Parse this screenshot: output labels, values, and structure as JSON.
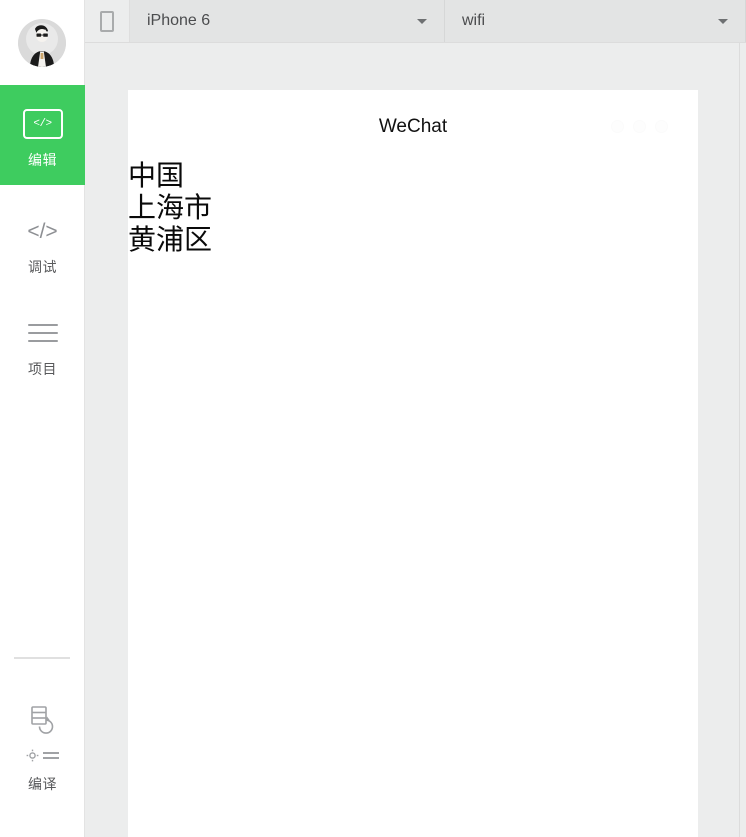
{
  "sidebar": {
    "avatar": {
      "name": "user-avatar",
      "alt": "user profile picture"
    },
    "items": [
      {
        "id": "edit",
        "label": "编辑",
        "icon": "code-box-icon",
        "icon_text": "</>",
        "active": true
      },
      {
        "id": "debug",
        "label": "调试",
        "icon": "code-brackets-icon",
        "icon_text": "</>",
        "active": false
      },
      {
        "id": "project",
        "label": "项目",
        "icon": "hamburger-lines-icon",
        "icon_text": "",
        "active": false
      },
      {
        "id": "compile",
        "label": "编译",
        "icon": "compile-refresh-icon",
        "icon_text": "",
        "active": false
      }
    ],
    "active_color": "#3ecc5f"
  },
  "toolbar": {
    "device_toggle": {
      "label": "",
      "icon": "phone-outline-icon"
    },
    "device_select": {
      "value": "iPhone 6",
      "placeholder": "iPhone 6"
    },
    "network_select": {
      "value": "wifi",
      "placeholder": "wifi"
    },
    "caret_icon": "chevron-down-icon"
  },
  "simulator": {
    "header": {
      "title": "WeChat",
      "menu_icon": "ellipsis-dots-icon"
    },
    "content": {
      "lines": [
        "中国",
        "上海市",
        "黄浦区"
      ]
    }
  }
}
